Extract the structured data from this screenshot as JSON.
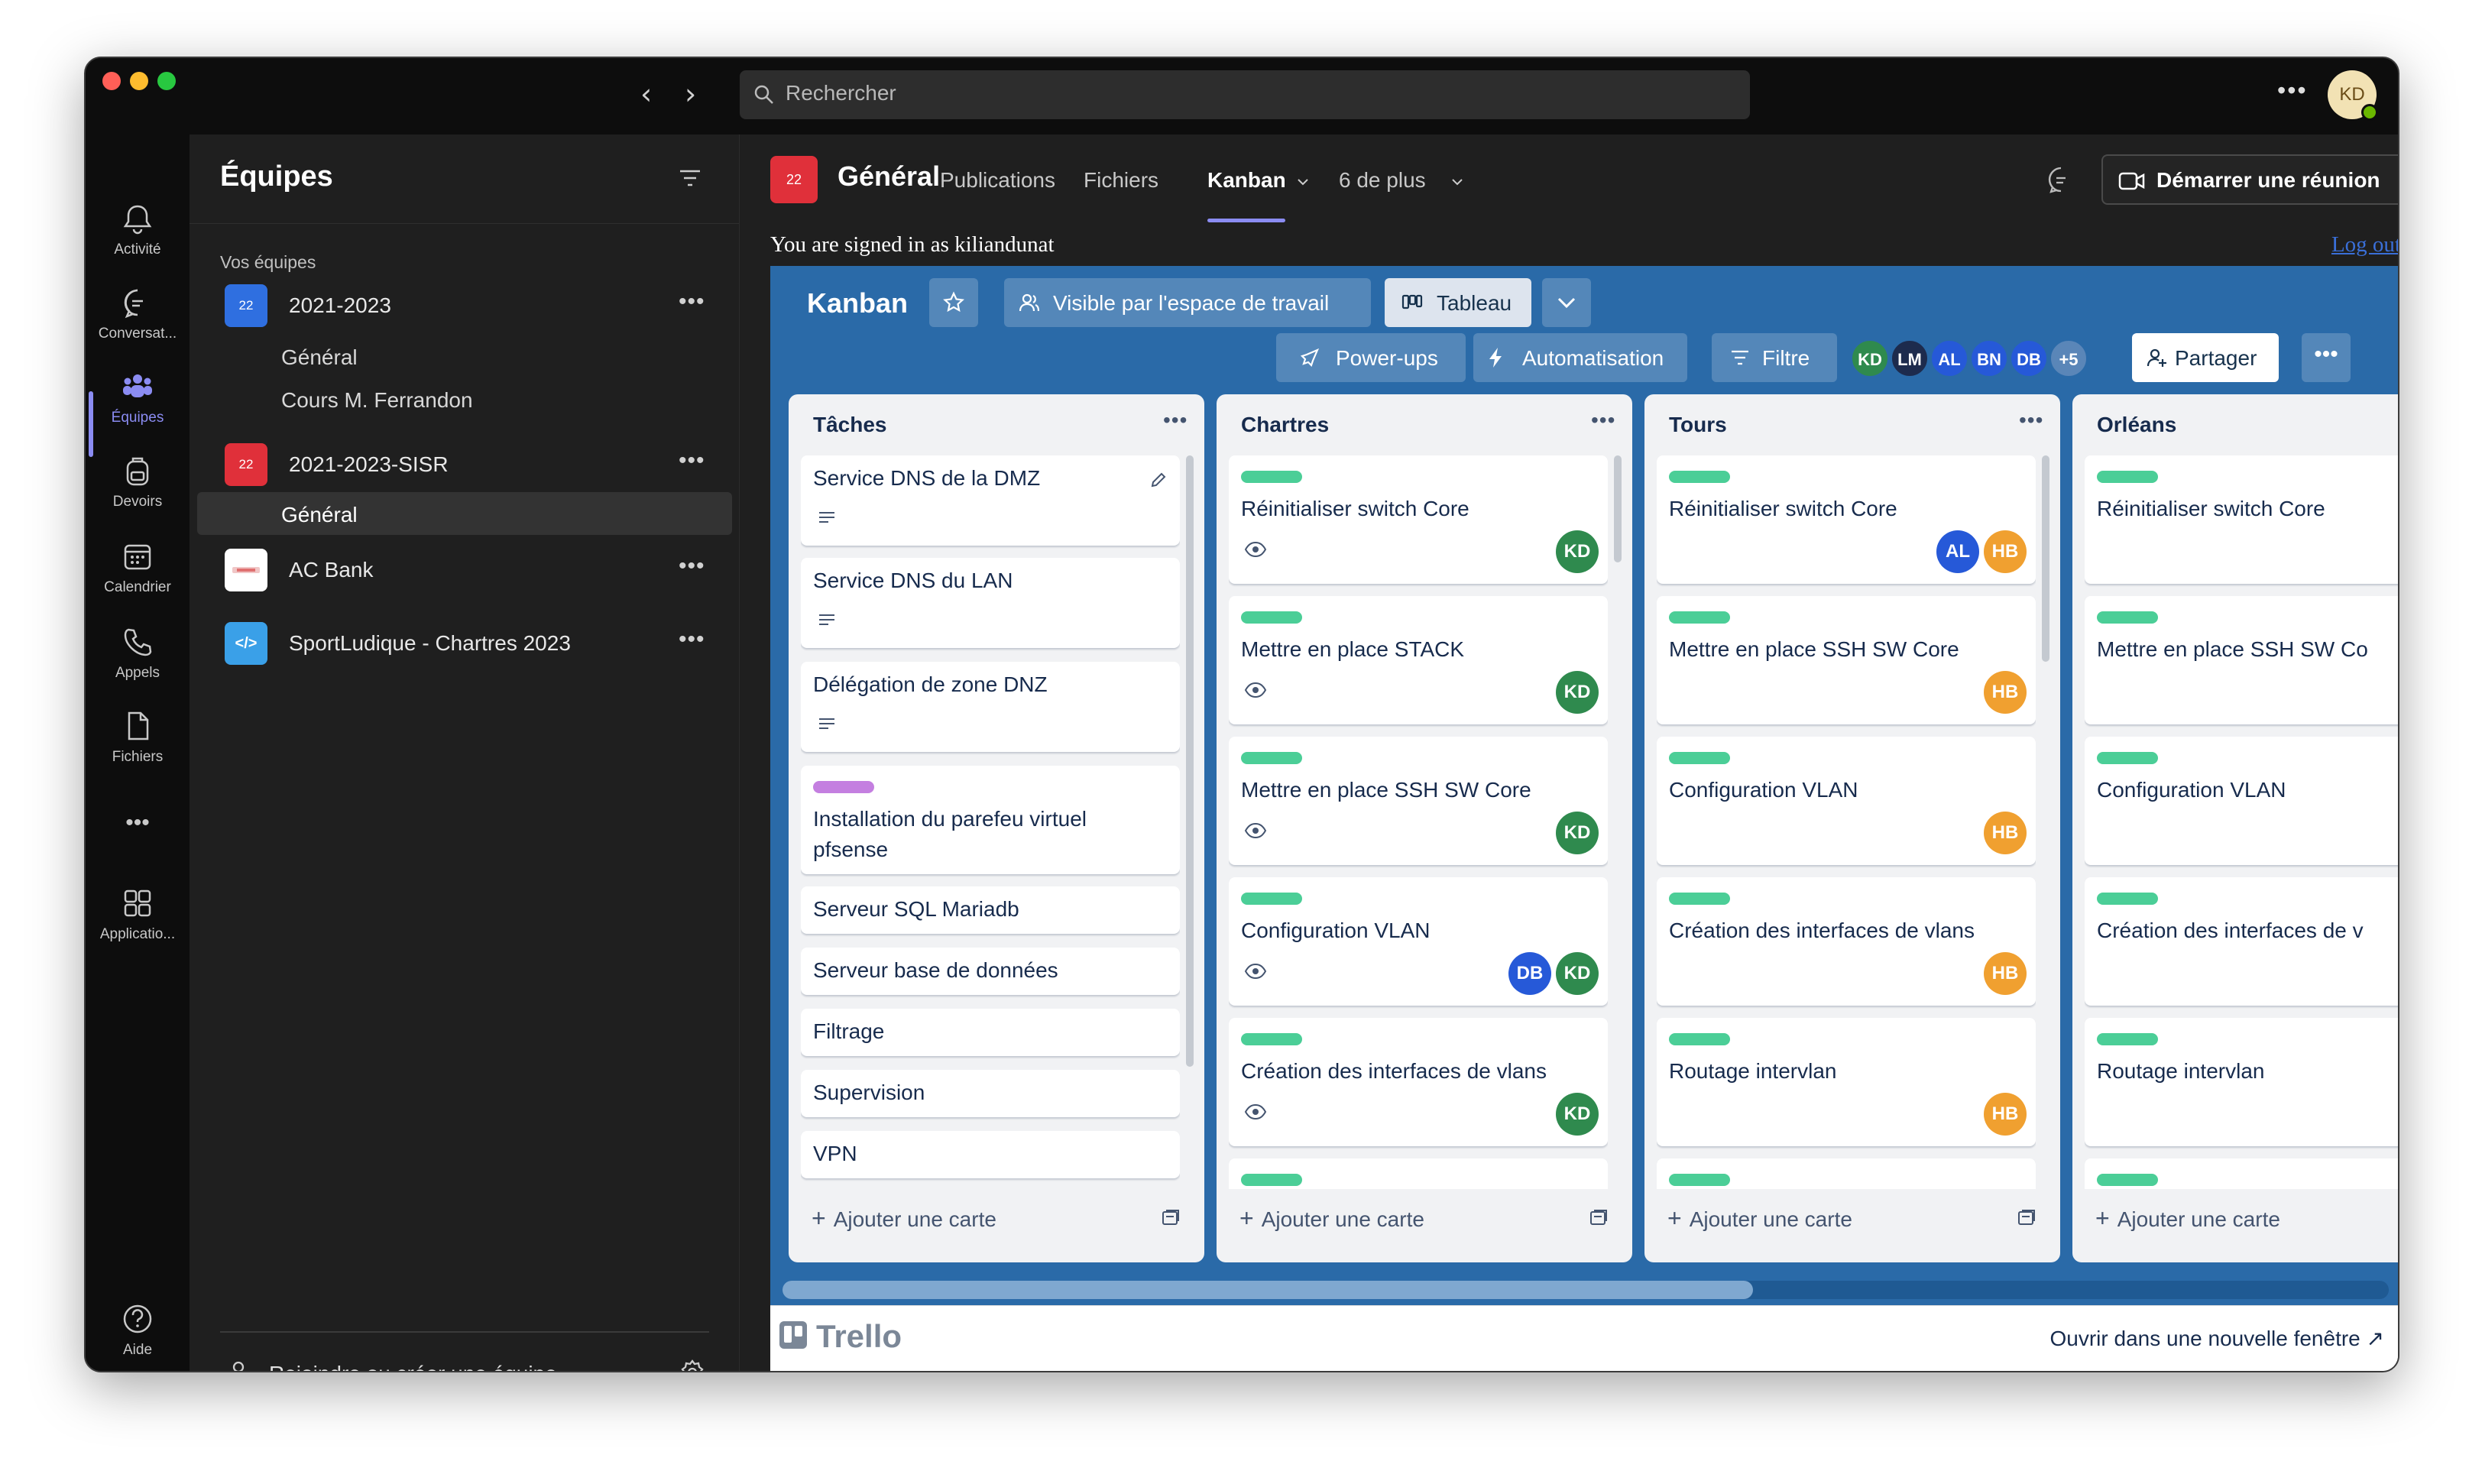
{
  "app": {
    "search_placeholder": "Rechercher",
    "user_initials": "KD"
  },
  "rail": [
    {
      "label": "Activité",
      "icon": "bell-icon"
    },
    {
      "label": "Conversat...",
      "icon": "chat-icon"
    },
    {
      "label": "Équipes",
      "icon": "teams-icon",
      "active": true
    },
    {
      "label": "Devoirs",
      "icon": "backpack-icon"
    },
    {
      "label": "Calendrier",
      "icon": "calendar-icon"
    },
    {
      "label": "Appels",
      "icon": "phone-icon"
    },
    {
      "label": "Fichiers",
      "icon": "file-icon"
    },
    {
      "label": "Applicatio...",
      "icon": "apps-icon"
    },
    {
      "label": "Aide",
      "icon": "help-icon"
    }
  ],
  "teams": {
    "title": "Équipes",
    "section": "Vos équipes",
    "items": [
      {
        "icon_text": "22",
        "name": "2021-2023",
        "color": "#2f6fe0",
        "channels": [
          "Général",
          "Cours M. Ferrandon"
        ]
      },
      {
        "icon_text": "22",
        "name": "2021-2023-SISR",
        "color": "#e0303a",
        "channels": [
          "Général"
        ]
      },
      {
        "icon_text": "",
        "name": "AC Bank",
        "color": "#ffffff",
        "channels": []
      },
      {
        "icon_text": "</>",
        "name": "SportLudique - Chartres 2023",
        "color": "#3aa0e8",
        "channels": []
      }
    ],
    "join": "Rejoindre ou créer une équipe"
  },
  "channel": {
    "icon_text": "22",
    "title": "Général",
    "tabs": [
      "Publications",
      "Fichiers",
      "Kanban",
      "6 de plus"
    ],
    "active_tab": "Kanban",
    "meet_button": "Démarrer une réunion"
  },
  "signin": {
    "text": "You are signed in as kiliandunat",
    "logout": "Log out"
  },
  "board": {
    "title": "Kanban",
    "visibility": "Visible par l'espace de travail",
    "view": "Tableau",
    "powerups": "Power-ups",
    "automation": "Automatisation",
    "filter": "Filtre",
    "members": [
      {
        "initials": "KD",
        "color": "#2f8a4e"
      },
      {
        "initials": "LM",
        "color": "#1d2b4d"
      },
      {
        "initials": "AL",
        "color": "#2659d8"
      },
      {
        "initials": "BN",
        "color": "#2659d8"
      },
      {
        "initials": "DB",
        "color": "#2659d8"
      },
      {
        "initials": "+5",
        "color": "#5a86b8"
      }
    ],
    "share": "Partager",
    "add_card": "Ajouter une carte",
    "lists": [
      {
        "title": "Tâches",
        "cards": [
          {
            "text": "Service DNS de la DMZ",
            "desc": true,
            "edit": true
          },
          {
            "text": "Service DNS du LAN",
            "desc": true
          },
          {
            "text": "Délégation de zone DNZ",
            "desc": true
          },
          {
            "text": "Installation du parefeu virtuel pfsense",
            "label": "purple"
          },
          {
            "text": "Serveur SQL Mariadb"
          },
          {
            "text": "Serveur base de données"
          },
          {
            "text": "Filtrage"
          },
          {
            "text": "Supervision"
          },
          {
            "text": "VPN"
          }
        ]
      },
      {
        "title": "Chartres",
        "cards": [
          {
            "text": "Réinitialiser switch Core",
            "label": "green",
            "watch": true,
            "members": [
              "KD"
            ]
          },
          {
            "text": "Mettre en place STACK",
            "label": "green",
            "watch": true,
            "members": [
              "KD"
            ]
          },
          {
            "text": "Mettre en place SSH SW Core",
            "label": "green",
            "watch": true,
            "members": [
              "KD"
            ]
          },
          {
            "text": "Configuration VLAN",
            "label": "green",
            "watch": true,
            "members": [
              "DB",
              "KD"
            ]
          },
          {
            "text": "Création des interfaces de vlans",
            "label": "green",
            "watch": true,
            "members": [
              "KD"
            ]
          }
        ]
      },
      {
        "title": "Tours",
        "cards": [
          {
            "text": "Réinitialiser switch Core",
            "label": "green",
            "members": [
              "AL",
              "HB"
            ]
          },
          {
            "text": "Mettre en place SSH SW Core",
            "label": "green",
            "members": [
              "HB"
            ]
          },
          {
            "text": "Configuration VLAN",
            "label": "green",
            "members": [
              "HB"
            ]
          },
          {
            "text": "Création des interfaces de vlans",
            "label": "green",
            "members": [
              "HB"
            ]
          },
          {
            "text": "Routage intervlan",
            "label": "green",
            "members": [
              "HB"
            ]
          }
        ]
      },
      {
        "title": "Orléans",
        "cards": [
          {
            "text": "Réinitialiser switch Core",
            "label": "green"
          },
          {
            "text": "Mettre en place SSH SW Co",
            "label": "green"
          },
          {
            "text": "Configuration VLAN",
            "label": "green"
          },
          {
            "text": "Création des interfaces de v",
            "label": "green"
          },
          {
            "text": "Routage intervlan",
            "label": "green"
          }
        ]
      }
    ],
    "member_colors": {
      "KD": "#2f8a4e",
      "DB": "#2659d8",
      "AL": "#2659d8",
      "HB": "#f0a030"
    }
  },
  "footer": {
    "logo": "Trello",
    "open_new": "Ouvrir dans une nouvelle fenêtre ↗"
  }
}
